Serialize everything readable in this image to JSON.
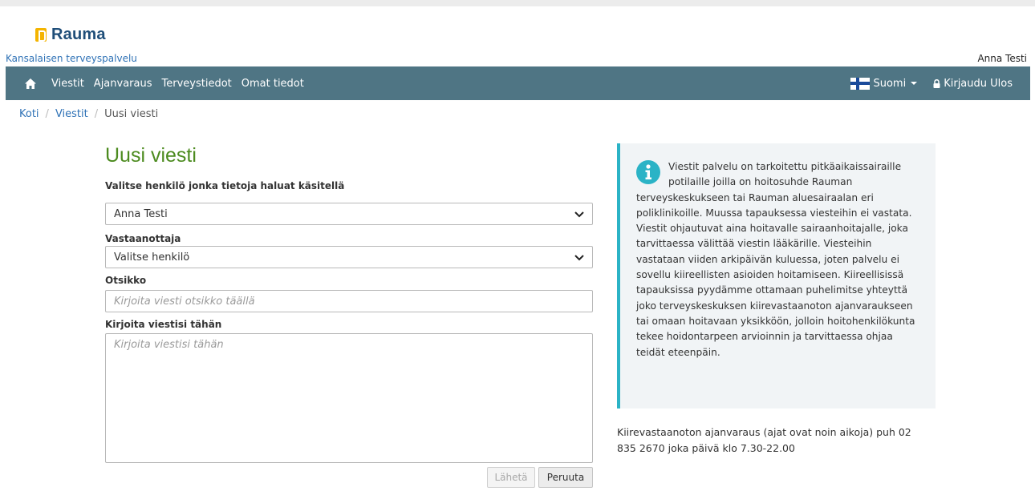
{
  "header": {
    "logo_text": "Rauma",
    "subtitle": "Kansalaisen terveyspalvelu",
    "username": "Anna Testi"
  },
  "nav": {
    "items": [
      "Viestit",
      "Ajanvaraus",
      "Terveystiedot",
      "Omat tiedot"
    ],
    "language": "Suomi",
    "logout": "Kirjaudu Ulos",
    "color": "#4f7584"
  },
  "breadcrumb": {
    "home": "Koti",
    "messages": "Viestit",
    "current": "Uusi viesti"
  },
  "form": {
    "title": "Uusi viesti",
    "person_label": "Valitse henkilö jonka tietoja haluat käsitellä",
    "person_value": "Anna Testi",
    "recipient_label": "Vastaanottaja",
    "recipient_value": "Valitse henkilö",
    "subject_label": "Otsikko",
    "subject_placeholder": "Kirjoita viesti otsikko täällä",
    "message_label": "Kirjoita viestisi tähän",
    "message_placeholder": "Kirjoita viestisi tähän",
    "send_label": "Lähetä",
    "cancel_label": "Peruuta"
  },
  "info": {
    "text": "Viestit palvelu on tarkoitettu pitkäaikaissairaille potilaille joilla on hoitosuhde Rauman terveyskeskukseen tai Rauman aluesairaalan eri poliklinikoille. Muussa tapauksessa viesteihin ei vastata. Viestit ohjautuvat aina hoitavalle sairaanhoitajalle, joka tarvittaessa välittää viestin lääkärille. Viesteihin vastataan viiden arkipäivän kuluessa, joten palvelu ei sovellu kiireellisten asioiden hoitamiseen. Kiireellisissä tapauksissa pyydämme ottamaan puhelimitse yhteyttä joko terveyskeskuksen kiirevastaanoton ajanvaraukseen tai omaan hoitavaan yksikköön, jolloin hoitohenkilökunta tekee hoidontarpeen arvioinnin ja tarvittaessa ohjaa teidät eteenpäin.",
    "accent": "#2bb3c6"
  },
  "phone_note": "Kiirevastaanoton ajanvaraus (ajat ovat noin aikoja) puh 02 835 2670 joka päivä klo 7.30-22.00",
  "colors": {
    "title_green": "#4c8b1f",
    "link_blue": "#2f72b6",
    "logo_yellow": "#f4b400",
    "logo_navy": "#1f4e79"
  }
}
